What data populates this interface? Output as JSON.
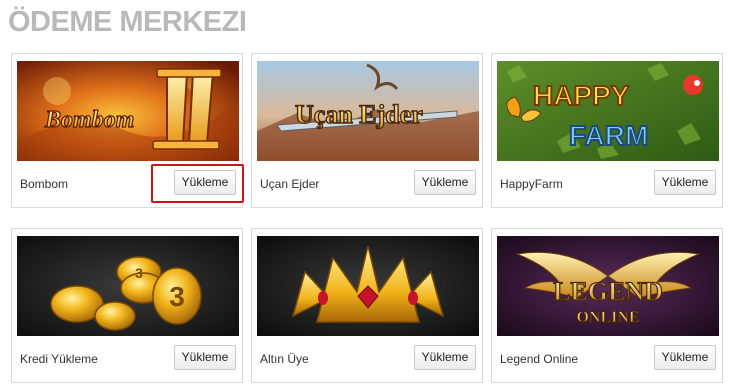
{
  "page": {
    "title": "ÖDEME MERKEZI"
  },
  "cards": [
    {
      "name": "Bombom",
      "button": "Yükleme",
      "logo_text": "Bombom II"
    },
    {
      "name": "Uçan Ejder",
      "button": "Yükleme",
      "logo_text": "Uçan Ejder"
    },
    {
      "name": "HappyFarm",
      "button": "Yükleme",
      "logo_text_1": "HAPPY",
      "logo_text_2": "FARM"
    },
    {
      "name": "Kredi Yükleme",
      "button": "Yükleme",
      "coin_label": "3"
    },
    {
      "name": "Altın Üye",
      "button": "Yükleme"
    },
    {
      "name": "Legend Online",
      "button": "Yükleme",
      "logo_text_1": "LEGEND",
      "logo_text_2": "ONLINE"
    }
  ],
  "colors": {
    "title": "#b9b9b9",
    "highlight": "#d0131a"
  }
}
